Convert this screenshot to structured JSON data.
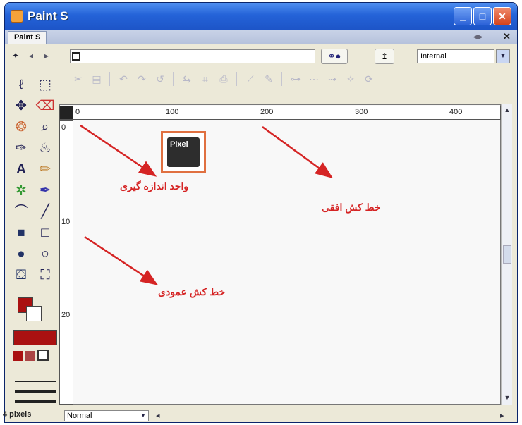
{
  "window": {
    "title": "Paint S",
    "tab_label": "Paint S"
  },
  "nav": {
    "select_value": "Internal"
  },
  "rulers": {
    "horizontal_ticks": [
      "0",
      "100",
      "200",
      "300",
      "400"
    ],
    "vertical_ticks": [
      "0",
      "10",
      "20"
    ]
  },
  "statusbar": {
    "mode_value": "Normal",
    "line_width_label": "4 pixels"
  },
  "annotations": {
    "unit": "واحد اندازه گیری",
    "horizontal_ruler": "خط کش افقی",
    "vertical_ruler": "خط کش عمودی"
  },
  "logo": {
    "text": "Pixel"
  },
  "colors": {
    "foreground": "#a11111",
    "annotation": "#d52424",
    "titlebar": "#2463d8"
  }
}
